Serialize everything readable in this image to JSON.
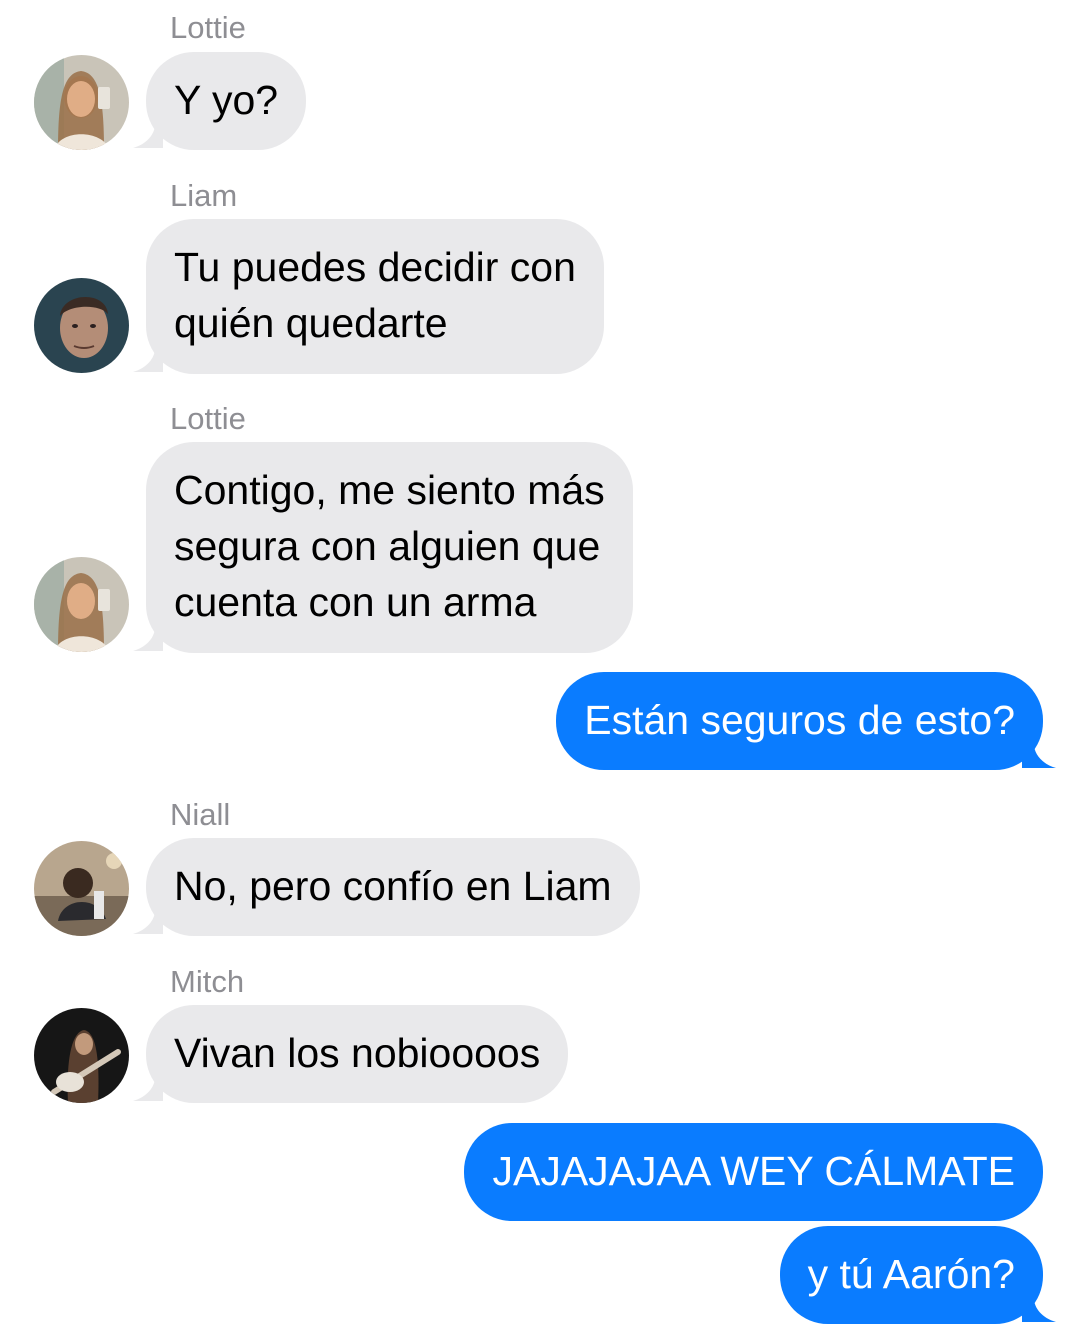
{
  "colors": {
    "incoming_bubble": "#e9e9eb",
    "outgoing_bubble": "#0a7cff",
    "sender_name": "#8e8e93"
  },
  "messages": [
    {
      "direction": "incoming",
      "sender": "Lottie",
      "avatar": "lottie-avatar",
      "text": "Y yo?"
    },
    {
      "direction": "incoming",
      "sender": "Liam",
      "avatar": "liam-avatar",
      "text": "Tu puedes decidir con\nquién quedarte"
    },
    {
      "direction": "incoming",
      "sender": "Lottie",
      "avatar": "lottie-avatar",
      "text": "Contigo, me siento más\nsegura con alguien que\ncuenta con un arma"
    },
    {
      "direction": "outgoing",
      "text": "Están seguros de esto?"
    },
    {
      "direction": "incoming",
      "sender": "Niall",
      "avatar": "niall-avatar",
      "text": "No, pero confío en Liam"
    },
    {
      "direction": "incoming",
      "sender": "Mitch",
      "avatar": "mitch-avatar",
      "text": "Vivan los nobioooos"
    },
    {
      "direction": "outgoing",
      "text": "JAJAJAJAA WEY CÁLMATE"
    },
    {
      "direction": "outgoing",
      "text": "y tú Aarón?"
    }
  ]
}
